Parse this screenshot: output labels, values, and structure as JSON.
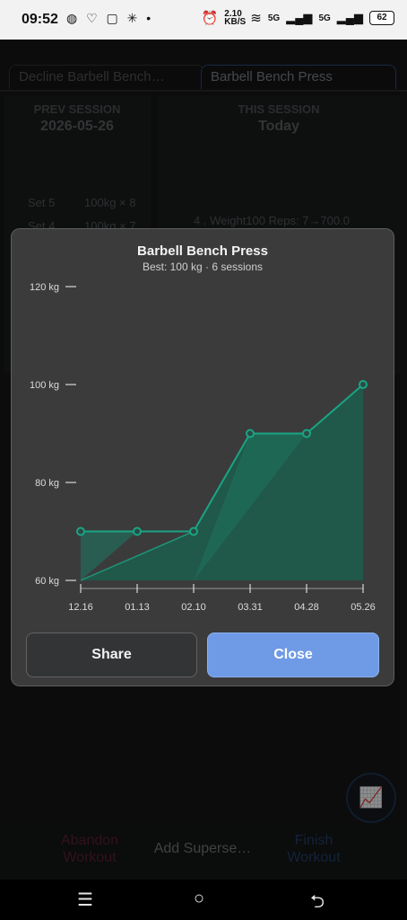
{
  "status": {
    "time": "09:52",
    "left_icons": "◍ ♡ ▢ ✳ •",
    "net_speed": "2.10 KB/S",
    "sim1": "5G",
    "sim2": "5G",
    "battery": "62"
  },
  "tabs": [
    {
      "label": "Decline Barbell Bench…"
    },
    {
      "label": "Barbell Bench Press"
    }
  ],
  "prev_session": {
    "header": "PREV SESSION",
    "date": "2026-05-26",
    "sets": [
      {
        "label": "Set 5",
        "value": "100kg × 8"
      },
      {
        "label": "Set 4",
        "value": "100kg × 7"
      }
    ]
  },
  "this_session": {
    "header": "THIS SESSION",
    "date": "Today",
    "note": "4 . Weight100 Reps: 7→700.0"
  },
  "bottom": {
    "abandon": "Abandon Workout",
    "superset": "Add Superse…",
    "finish": "Finish Workout"
  },
  "modal": {
    "title": "Barbell Bench Press",
    "subtitle": "Best: 100 kg · 6 sessions",
    "share_label": "Share",
    "close_label": "Close"
  },
  "chart_data": {
    "type": "line",
    "x": [
      "12.16",
      "01.13",
      "02.10",
      "03.31",
      "04.28",
      "05.26"
    ],
    "series": [
      {
        "values": [
          70,
          70,
          70,
          90,
          90,
          100
        ]
      }
    ],
    "yticks": [
      "60 kg",
      "80 kg",
      "100 kg",
      "120 kg"
    ],
    "ylim": [
      60,
      120
    ],
    "color": "#1aa584",
    "fill": "#1f5a4a"
  },
  "colors": {
    "accent": "#6e9ae6",
    "chart_line": "#1aa584"
  }
}
